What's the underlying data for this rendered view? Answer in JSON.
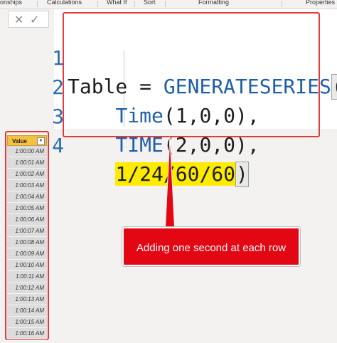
{
  "ribbon": {
    "items": [
      "onships",
      "Calculations",
      "What If",
      "Sort",
      "Formatting",
      "Properties"
    ]
  },
  "formula_bar": {
    "cancel_icon": "✕",
    "commit_icon": "✓",
    "lines": [
      {
        "num": "1",
        "pre": "Table = ",
        "kw": "GENERATESERIES",
        "post": "("
      },
      {
        "num": "2",
        "indent": "    ",
        "kw": "Time",
        "post": "(1,0,0),"
      },
      {
        "num": "3",
        "indent": "    ",
        "kw": "TIME",
        "post": "(2,0,0),"
      },
      {
        "num": "4",
        "indent": "    ",
        "hl": "1/24/60/60",
        "post": ")"
      }
    ]
  },
  "table": {
    "header": "Value",
    "rows": [
      "1:00:00 AM",
      "1:00:01 AM",
      "1:00:02 AM",
      "1:00:03 AM",
      "1:00:04 AM",
      "1:00:05 AM",
      "1:00:06 AM",
      "1:00:07 AM",
      "1:00:08 AM",
      "1:00:09 AM",
      "1:00:10 AM",
      "1:00:11 AM",
      "1:00:12 AM",
      "1:00:13 AM",
      "1:00:14 AM",
      "1:00:15 AM",
      "1:00:16 AM"
    ]
  },
  "callout": {
    "text": "Adding one second at each row",
    "color": "#e30613"
  },
  "colors": {
    "highlight": "#ffeb00",
    "keyword": "#1f5fa8",
    "annotation_border": "#e33a3a",
    "header_fill": "#f4c142"
  }
}
